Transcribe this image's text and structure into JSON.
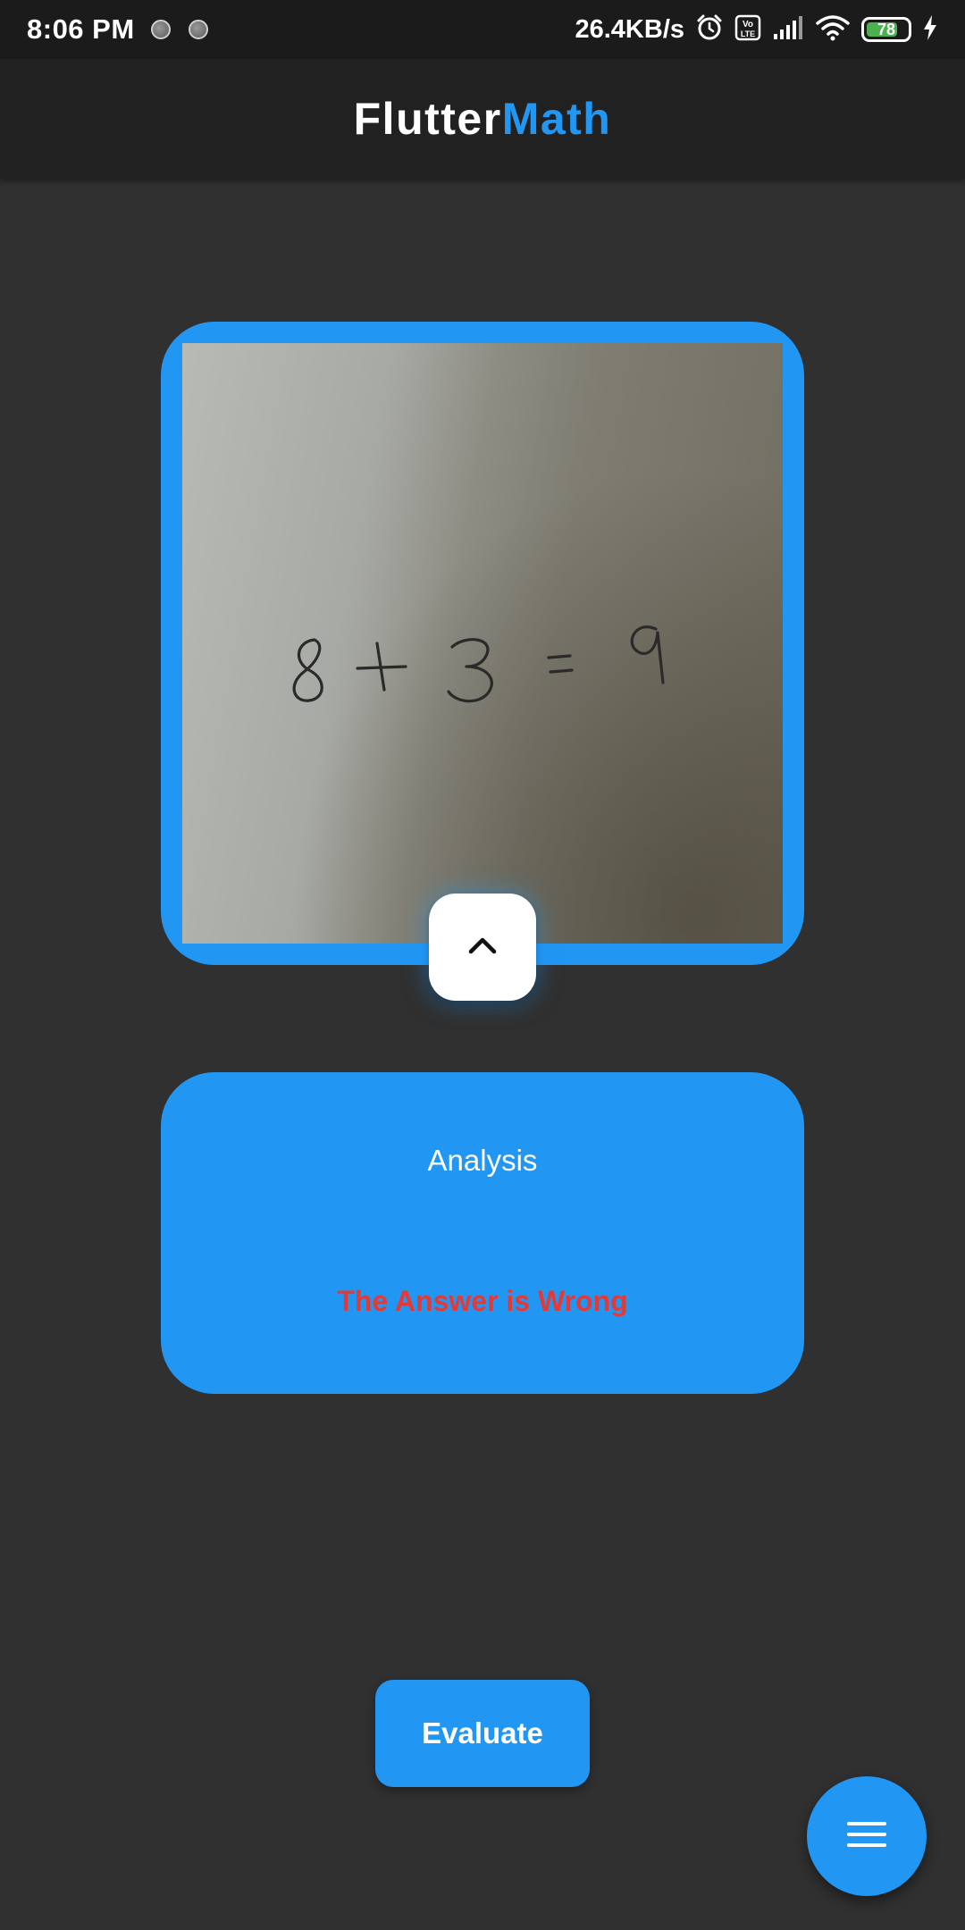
{
  "status_bar": {
    "time": "8:06 PM",
    "net_speed": "26.4KB/s",
    "battery_level": 78,
    "battery_text": "78",
    "icons": [
      "notification-icon",
      "notification-icon",
      "alarm-icon",
      "volte-icon",
      "signal-icon",
      "wifi-icon",
      "battery-icon",
      "charging-icon"
    ]
  },
  "app_bar": {
    "title_part_1": "Flutter",
    "title_part_2": "Math"
  },
  "image_card": {
    "handwritten_equation": "8 + 3 = 9",
    "expand_icon": "chevron-up-icon"
  },
  "analysis": {
    "title": "Analysis",
    "result": "The Answer is Wrong"
  },
  "actions": {
    "evaluate_label": "Evaluate",
    "menu_icon": "menu-icon"
  },
  "colors": {
    "accent": "#2196f3",
    "background": "#303030",
    "app_bar": "#212121",
    "status_bar": "#1b1b1b",
    "error": "#e53935",
    "battery_fill": "#4caf50"
  }
}
